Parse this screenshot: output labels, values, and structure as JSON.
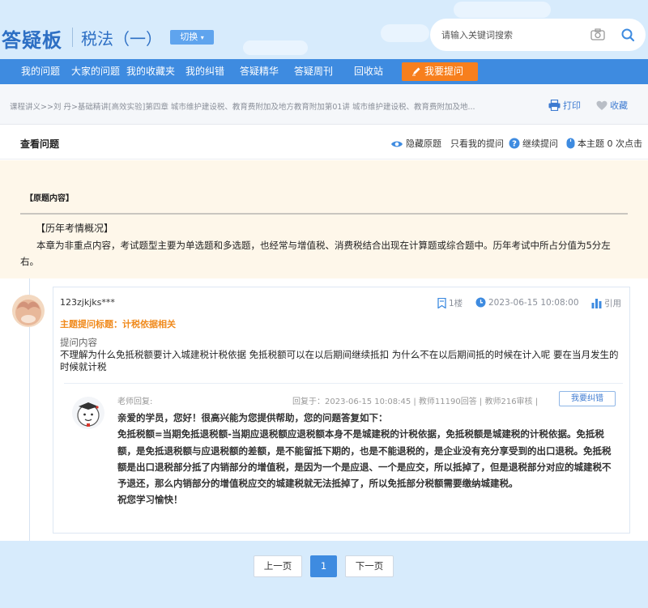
{
  "header": {
    "logo": "答疑板",
    "subject": "税法（一）",
    "switch_label": "切换",
    "search_placeholder": "请输入关键词搜索"
  },
  "nav": {
    "items": [
      "我的问题",
      "大家的问题",
      "我的收藏夹",
      "我的纠错",
      "答疑精华",
      "答疑周刊",
      "回收站"
    ],
    "ask_label": "我要提问"
  },
  "breadcrumb": {
    "text": "课程讲义>>刘 丹>基础精讲[高效实验]第四章 城市维护建设税、教育费附加及地方教育附加第01讲 城市维护建设税、教育费附加及地...",
    "print_label": "打印",
    "favorite_label": "收藏"
  },
  "view_bar": {
    "title": "查看问题",
    "hide_original": "隐藏原题",
    "only_mine": "只看我的提问",
    "continue_ask": "继续提问",
    "topic_count": "本主题 0 次点击"
  },
  "original": {
    "label": "【原题内容】",
    "heading": "【历年考情概况】",
    "body": "本章为非重点内容，考试题型主要为单选题和多选题，也经常与增值税、消费税结合出现在计算题或综合题中。历年考试中所占分值为5分左右。"
  },
  "question": {
    "user": "123zjkjks***",
    "floor": "1楼",
    "time": "2023-06-15 10:08:00",
    "quote_label": "引用",
    "topic": "主题提问标题：计税依据相关",
    "content_label": "提问内容",
    "content": "不理解为什么免抵税额要计入城建税计税依据 免抵税额可以在以后期间继续抵扣 为什么不在以后期间抵的时候在计入呢 要在当月发生的时候就计税"
  },
  "reply": {
    "label": "老师回复:",
    "meta": "回复于：2023-06-15 10:08:45 | 教师11190回答 | 教师216审核 |",
    "report_label": "我要纠错",
    "lines": [
      "亲爱的学员，您好！很高兴能为您提供帮助，您的问题答复如下：",
      "免抵税额=当期免抵退税额-当期应退税额应退税额本身不是城建税的计税依据，免抵税额是城建税的计税依据。免抵税额，是免抵退税额与应退税额的差额，是不能留抵下期的，也是不能退税的，是企业没有充分享受到的出口退税。免抵税额是出口退税部分抵了内销部分的增值税，是因为一个是应退、一个是应交，所以抵掉了，但是退税部分对应的城建税不予退还，那么内销部分的增值税应交的城建税就无法抵掉了，所以免抵部分税额需要缴纳城建税。",
      "祝您学习愉快！"
    ]
  },
  "pager": {
    "prev": "上一页",
    "current": "1",
    "next": "下一页"
  },
  "colors": {
    "brand_blue": "#3e8be0",
    "ask_orange": "#f77f1d",
    "topic_orange": "#f08a1c",
    "header_bg": "#d7ebfc"
  }
}
